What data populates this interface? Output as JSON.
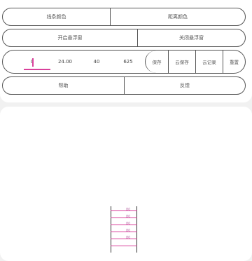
{
  "row1": {
    "line_color_label": "线条颜色",
    "distance_color_label": "距离颜色"
  },
  "row2": {
    "open_float_label": "开启悬浮窗",
    "close_float_label": "关闭悬浮窗"
  },
  "row3": {
    "values": [
      "0",
      "24.00",
      "40",
      "625"
    ],
    "save_label": "保存",
    "cloud_save_label": "云保存",
    "cloud_record_label": "云记录",
    "reset_label": "重置"
  },
  "row4": {
    "help_label": "帮助",
    "feedback_label": "反馈"
  },
  "ruler": {
    "labels": [
      "80",
      "80",
      "80",
      "80",
      "80"
    ]
  },
  "colors": {
    "accent": "#d9409b",
    "border": "#555555"
  }
}
